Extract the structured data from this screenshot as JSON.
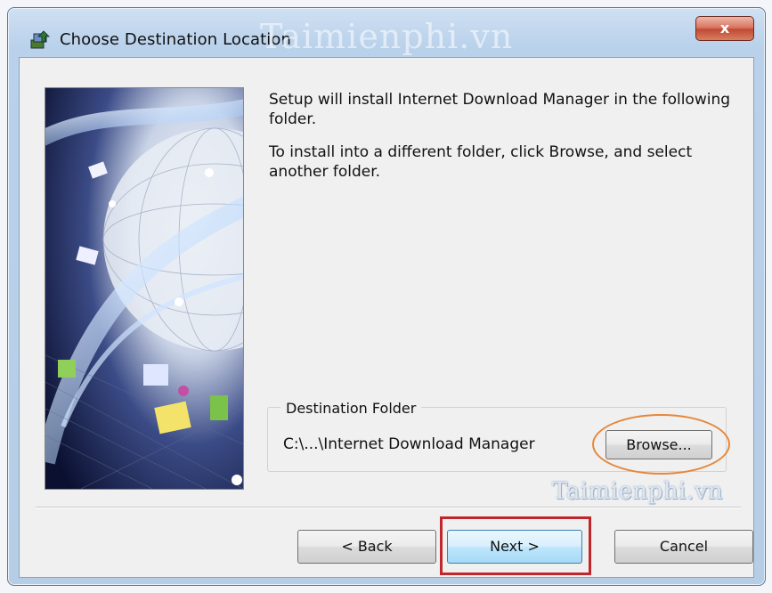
{
  "window": {
    "title": "Choose Destination Location",
    "close_label": "x",
    "watermark": "Taimienphi.vn"
  },
  "content": {
    "message1": "Setup will install Internet Download Manager in the following folder.",
    "message2": "To install into a different folder, click Browse, and select another folder."
  },
  "destination": {
    "group_label": "Destination Folder",
    "path": "C:\\...\\Internet Download Manager",
    "browse_label": "Browse..."
  },
  "buttons": {
    "back_label": "< Back",
    "next_label": "Next >",
    "cancel_label": "Cancel"
  },
  "annotations": {
    "watermark_bottom": "Taimienphi.vn",
    "oval_color": "#e5873a",
    "highlight_color": "#c0272d"
  },
  "icons": {
    "app": "installer-icon",
    "close": "close-icon"
  }
}
